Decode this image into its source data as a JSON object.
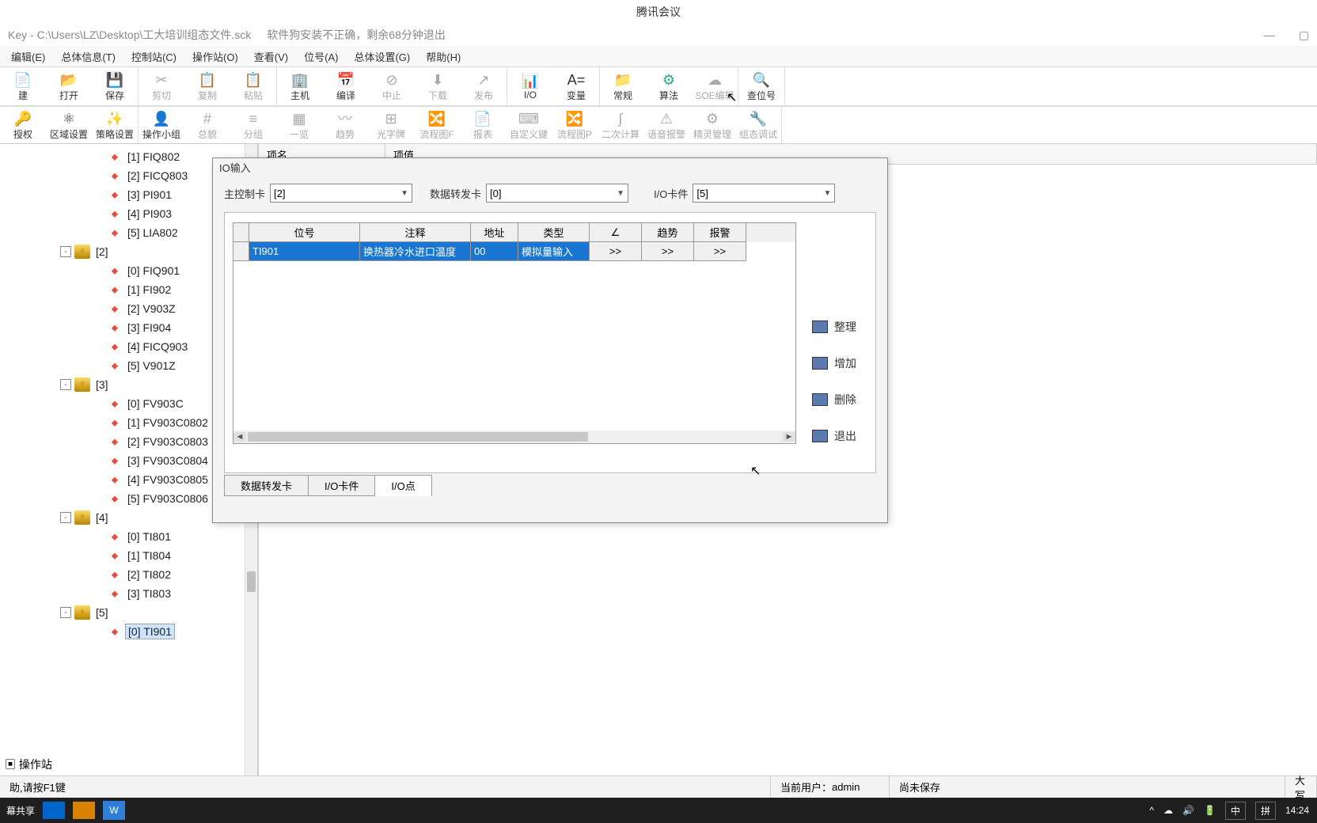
{
  "meeting_app": "腾讯会议",
  "titlebar": {
    "file_info": "Key - C:\\Users\\LZ\\Desktop\\工大培训组态文件.sck",
    "warning": "软件狗安装不正确，剩余68分钟退出",
    "minimize": "—",
    "maximize": "▢"
  },
  "menu": [
    "编辑(E)",
    "总体信息(T)",
    "控制站(C)",
    "操作站(O)",
    "查看(V)",
    "位号(A)",
    "总体设置(G)",
    "帮助(H)"
  ],
  "toolbar1": {
    "g1": [
      {
        "icon": "📄",
        "label": "建",
        "disabled": false
      },
      {
        "icon": "📂",
        "label": "打开",
        "disabled": false,
        "color": "#d4a017"
      },
      {
        "icon": "💾",
        "label": "保存",
        "disabled": false
      }
    ],
    "g2": [
      {
        "icon": "✂",
        "label": "剪切",
        "disabled": true
      },
      {
        "icon": "📋",
        "label": "复制",
        "disabled": true
      },
      {
        "icon": "📋",
        "label": "粘贴",
        "disabled": true
      }
    ],
    "g3": [
      {
        "icon": "🏢",
        "label": "主机",
        "color": "#2a8"
      },
      {
        "icon": "📅",
        "label": "编译"
      },
      {
        "icon": "⊘",
        "label": "中止",
        "disabled": true
      },
      {
        "icon": "⬇",
        "label": "下载",
        "disabled": true
      },
      {
        "icon": "↗",
        "label": "发布",
        "disabled": true
      }
    ],
    "g4": [
      {
        "icon": "📊",
        "label": "I/O",
        "color": "#2a8"
      },
      {
        "icon": "A=",
        "label": "变量"
      }
    ],
    "g5": [
      {
        "icon": "📁",
        "label": "常规"
      },
      {
        "icon": "⚙",
        "label": "算法",
        "color": "#2a8"
      },
      {
        "icon": "☁",
        "label": "SOE编辑",
        "disabled": true
      }
    ],
    "g6": [
      {
        "icon": "🔍",
        "label": "查位号",
        "color": "#2a8"
      }
    ]
  },
  "toolbar2": {
    "g1": [
      {
        "icon": "🔑",
        "label": "授权"
      },
      {
        "icon": "⚛",
        "label": "区域设置"
      },
      {
        "icon": "✨",
        "label": "策略设置"
      }
    ],
    "g2": [
      {
        "icon": "👤",
        "label": "操作小组"
      },
      {
        "icon": "#",
        "label": "总貌",
        "disabled": true
      },
      {
        "icon": "≡",
        "label": "分组",
        "disabled": true
      },
      {
        "icon": "▦",
        "label": "一览",
        "disabled": true
      },
      {
        "icon": "〰",
        "label": "趋势",
        "disabled": true
      },
      {
        "icon": "⊞",
        "label": "光字牌",
        "disabled": true
      },
      {
        "icon": "🔀",
        "label": "流程图F",
        "disabled": true
      },
      {
        "icon": "📄",
        "label": "报表",
        "disabled": true
      },
      {
        "icon": "⌨",
        "label": "自定义键",
        "disabled": true
      },
      {
        "icon": "🔀",
        "label": "流程图P",
        "disabled": true
      },
      {
        "icon": "∫",
        "label": "二次计算",
        "disabled": true
      },
      {
        "icon": "⚠",
        "label": "语音报警",
        "disabled": true
      },
      {
        "icon": "⚙",
        "label": "精灵管理",
        "disabled": true
      },
      {
        "icon": "🔧",
        "label": "组态调试",
        "disabled": true
      }
    ]
  },
  "tree": [
    {
      "indent": 3,
      "type": "tag",
      "label": "[1] FIQ802"
    },
    {
      "indent": 3,
      "type": "tag",
      "label": "[2] FICQ803"
    },
    {
      "indent": 3,
      "type": "tag",
      "label": "[3] PI901"
    },
    {
      "indent": 3,
      "type": "tag",
      "label": "[4] PI903"
    },
    {
      "indent": 3,
      "type": "tag",
      "label": "[5] LIA802"
    },
    {
      "indent": 2,
      "type": "card",
      "label": "[2]",
      "exp": "-"
    },
    {
      "indent": 3,
      "type": "tag",
      "label": "[0] FIQ901"
    },
    {
      "indent": 3,
      "type": "tag",
      "label": "[1] FI902"
    },
    {
      "indent": 3,
      "type": "tag",
      "label": "[2] V903Z"
    },
    {
      "indent": 3,
      "type": "tag",
      "label": "[3] FI904"
    },
    {
      "indent": 3,
      "type": "tag",
      "label": "[4] FICQ903"
    },
    {
      "indent": 3,
      "type": "tag",
      "label": "[5] V901Z"
    },
    {
      "indent": 2,
      "type": "card",
      "label": "[3]",
      "exp": "-"
    },
    {
      "indent": 3,
      "type": "tag",
      "label": "[0] FV903C"
    },
    {
      "indent": 3,
      "type": "tag",
      "label": "[1] FV903C0802"
    },
    {
      "indent": 3,
      "type": "tag",
      "label": "[2] FV903C0803"
    },
    {
      "indent": 3,
      "type": "tag",
      "label": "[3] FV903C0804"
    },
    {
      "indent": 3,
      "type": "tag",
      "label": "[4] FV903C0805"
    },
    {
      "indent": 3,
      "type": "tag",
      "label": "[5] FV903C0806"
    },
    {
      "indent": 2,
      "type": "card",
      "label": "[4]",
      "exp": "-"
    },
    {
      "indent": 3,
      "type": "tag",
      "label": "[0] TI801"
    },
    {
      "indent": 3,
      "type": "tag",
      "label": "[1] TI804"
    },
    {
      "indent": 3,
      "type": "tag",
      "label": "[2] TI802"
    },
    {
      "indent": 3,
      "type": "tag",
      "label": "[3] TI803"
    },
    {
      "indent": 2,
      "type": "card",
      "label": "[5]",
      "exp": "-"
    },
    {
      "indent": 3,
      "type": "tag",
      "label": "[0] TI901",
      "sel": true
    }
  ],
  "tree_footer": "操作站",
  "main_header": {
    "col1": "项名",
    "col2": "项值"
  },
  "dialog": {
    "title": "IO输入",
    "combos": {
      "main_card_label": "主控制卡",
      "main_card_value": "[2]",
      "data_card_label": "数据转发卡",
      "data_card_value": "[0]",
      "io_card_label": "I/O卡件",
      "io_card_value": "[5]"
    },
    "grid": {
      "headers": [
        "",
        "位号",
        "注释",
        "地址",
        "类型",
        "∠",
        "趋势",
        "报警"
      ],
      "row": {
        "tag": "TI901",
        "note": "换热器冷水进口温度",
        "addr": "00",
        "type": "模拟量输入",
        "b1": ">>",
        "b2": ">>",
        "b3": ">>"
      }
    },
    "side_btns": [
      "整理",
      "增加",
      "删除",
      "退出"
    ],
    "tabs": [
      "数据转发卡",
      "I/O卡件",
      "I/O点"
    ],
    "active_tab": 2
  },
  "status": {
    "help": "助,请按F1键",
    "user_label": "当前用户：",
    "user_value": "admin",
    "save_state": "尚未保存",
    "caps": "大写"
  },
  "taskbar": {
    "share": "幕共享",
    "ime1": "中",
    "ime2": "拼",
    "time": "14:24"
  }
}
